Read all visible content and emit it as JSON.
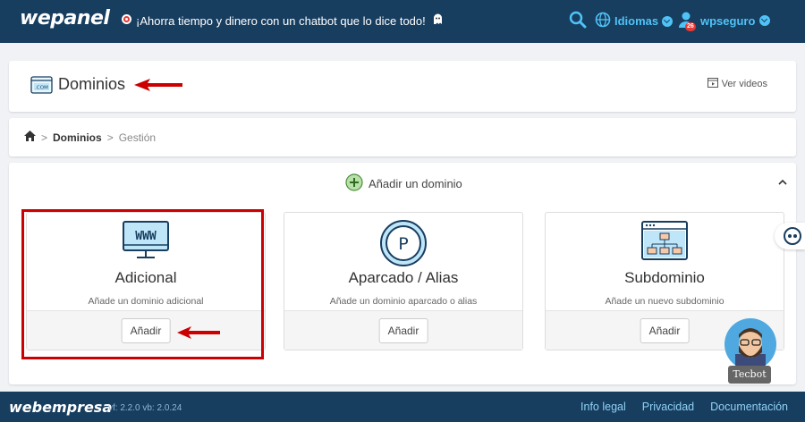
{
  "header": {
    "logo": "wepanel",
    "promo_text": "¡Ahorra tiempo y dinero con un chatbot que lo dice todo!",
    "languages_label": "Idiomas",
    "user_label": "wpseguro",
    "notification_count": "26"
  },
  "title_card": {
    "title": "Dominios",
    "videos_label": "Ver videos"
  },
  "breadcrumb": {
    "item1": "Dominios",
    "separator": ">",
    "item2": "Gestión"
  },
  "add_domain": {
    "label": "Añadir un dominio"
  },
  "options": [
    {
      "icon_text": "WWW",
      "title": "Adicional",
      "description": "Añade un dominio adicional",
      "button": "Añadir"
    },
    {
      "icon_text": "P",
      "title": "Aparcado / Alias",
      "description": "Añade un dominio aparcado o alias",
      "button": "Añadir"
    },
    {
      "icon_text": "",
      "title": "Subdominio",
      "description": "Añade un nuevo subdominio",
      "button": "Añadir"
    }
  ],
  "footer": {
    "logo": "webempresa",
    "version": "vf: 2.2.0 vb: 2.0.24",
    "links": [
      "Info legal",
      "Privacidad",
      "Documentación"
    ]
  },
  "chatbot": {
    "label": "Tecbot"
  },
  "colors": {
    "header_bg": "#173d5f",
    "accent": "#4fc3f7",
    "highlight": "#cc0000"
  }
}
